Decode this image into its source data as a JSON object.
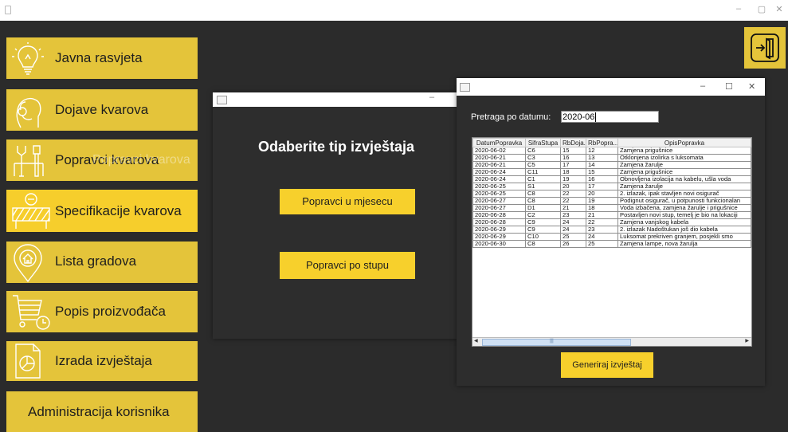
{
  "titlebar": {
    "minimize": "–",
    "maximize": "▢",
    "close": "✕"
  },
  "sidebar": {
    "items": [
      {
        "label": "Javna rasvjeta",
        "icon": "light-bulb-icon"
      },
      {
        "label": "Dojave kvarova",
        "icon": "headset-icon"
      },
      {
        "label": "Popravci kvarova",
        "ghost": "Popravci kvarova",
        "icon": "tools-icon"
      },
      {
        "label": "Specifikacije kvarova",
        "icon": "barrier-icon"
      },
      {
        "label": "Lista gradova",
        "icon": "map-pin-house-icon"
      },
      {
        "label": "Popis proizvođača",
        "icon": "shopping-cart-icon"
      },
      {
        "label": "Izrada izvještaja",
        "icon": "report-document-icon"
      },
      {
        "label": "Administracija korisnika"
      }
    ]
  },
  "exit": {
    "icon": "exit-door-icon"
  },
  "report_type_window": {
    "minimize": "–",
    "title": "Odaberite tip izvještaja",
    "btn_month": "Popravci u mjesecu",
    "btn_pole": "Popravci po stupu"
  },
  "repairs_window": {
    "minimize": "–",
    "maximize": "☐",
    "close": "✕",
    "search_label": "Pretraga po datumu:",
    "search_value": "2020-06",
    "columns": [
      "DatumPopravka",
      "SifraStupa",
      "RbDoja...",
      "RbPopra...",
      "OpisPopravka"
    ],
    "rows": [
      [
        "2020-06-02",
        "C6",
        "15",
        "12",
        "Zamjena prigušnice"
      ],
      [
        "2020-06-21",
        "C3",
        "16",
        "13",
        "Otklonjena izolirka s luksomata"
      ],
      [
        "2020-06-21",
        "C5",
        "17",
        "14",
        "Zamjena žarulje"
      ],
      [
        "2020-06-24",
        "C11",
        "18",
        "15",
        "Zamjena prigušnice"
      ],
      [
        "2020-06-24",
        "C1",
        "19",
        "16",
        "Obnovljena izolacija na kabelu, ušla voda"
      ],
      [
        "2020-06-25",
        "S1",
        "20",
        "17",
        "Zamjena žarulje"
      ],
      [
        "2020-06-25",
        "C8",
        "22",
        "20",
        "2. izlazak, ipak stavljen novi osigurač"
      ],
      [
        "2020-06-27",
        "C8",
        "22",
        "19",
        "Podignut osigurač, u potpunosti funkcionalan"
      ],
      [
        "2020-06-27",
        "D1",
        "21",
        "18",
        "Voda izbačena, zamjena žarulje i prigušnice"
      ],
      [
        "2020-06-28",
        "C2",
        "23",
        "21",
        "Postavljen novi stup, temelj je bio na lokaciji"
      ],
      [
        "2020-06-28",
        "C9",
        "24",
        "22",
        "Zamjena vanjskog kabela"
      ],
      [
        "2020-06-29",
        "C9",
        "24",
        "23",
        "2. izlazak Nadoštukan još dio kabela"
      ],
      [
        "2020-06-29",
        "C10",
        "25",
        "24",
        "Luksomat prekriven granjem, posjekli smo"
      ],
      [
        "2020-06-30",
        "C8",
        "26",
        "25",
        "Zamjena lampe, nova žarulja"
      ]
    ],
    "scroll_left": "◀",
    "scroll_grip": "|||",
    "scroll_right": "▶",
    "generate_btn": "Generiraj izvještaj"
  }
}
